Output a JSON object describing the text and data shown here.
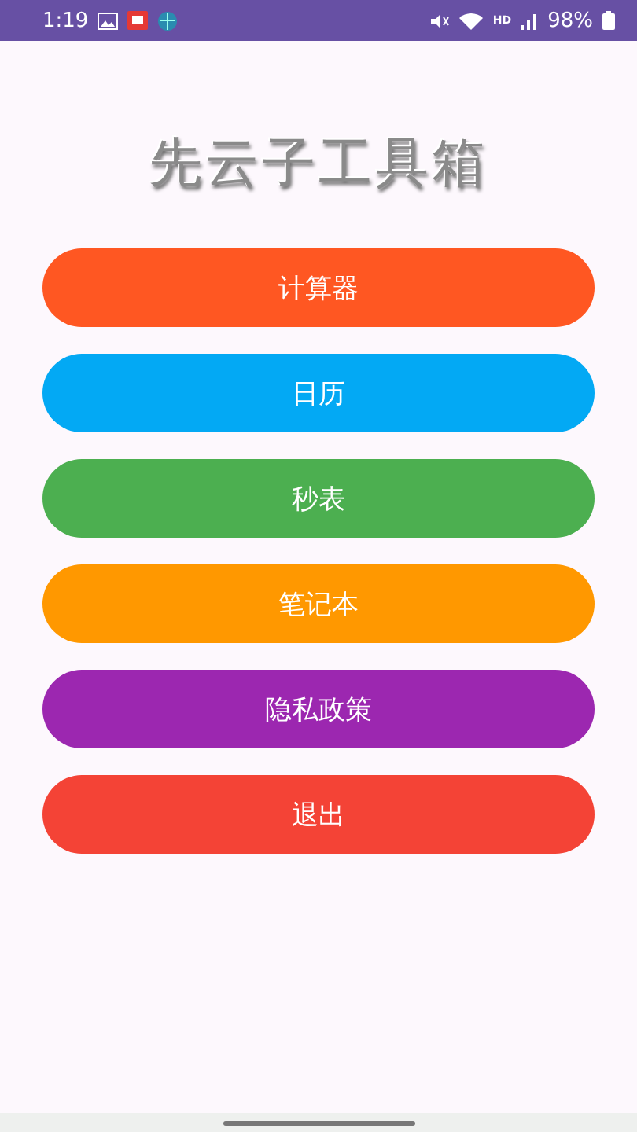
{
  "status_bar": {
    "time": "1:19",
    "network": "HD",
    "battery": "98%"
  },
  "title": "先云子工具箱",
  "buttons": [
    {
      "label": "计算器",
      "color": "#ff5722"
    },
    {
      "label": "日历",
      "color": "#03a9f4"
    },
    {
      "label": "秒表",
      "color": "#4caf50"
    },
    {
      "label": "笔记本",
      "color": "#ff9800"
    },
    {
      "label": "隐私政策",
      "color": "#9c27b0"
    },
    {
      "label": "退出",
      "color": "#f44336"
    }
  ]
}
